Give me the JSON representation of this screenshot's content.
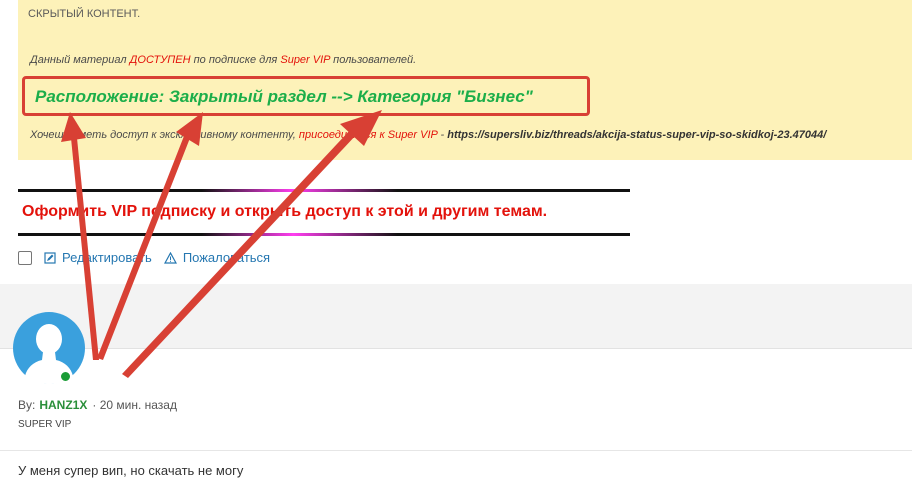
{
  "post": {
    "hidden_content_title": "Скрытый контент.",
    "vip_notice": {
      "pre": "Данный материал ",
      "available": "ДОСТУПЕН",
      "mid": " по подписке для ",
      "super_vip": "Super VIP",
      "post": " пользователей."
    },
    "location_text": "Расположение: Закрытый раздел --> Категория \"Бизнес\"",
    "access_line": {
      "pre": "Хочешь иметь доступ к эксклюзивному контенту, ",
      "join": "присоединяйся к Super VIP",
      "dash": " - ",
      "url": "https://supersliv.biz/threads/akcija-status-super-vip-so-skidkoj-23.47044/"
    },
    "promo_text": "Оформить VIP подписку и открыть доступ к этой и другим темам.",
    "actions": {
      "edit": "Редактировать",
      "report": "Пожаловаться"
    }
  },
  "reply": {
    "by_label": "By:",
    "author": "HANZ1X",
    "time": "20 мин. назад",
    "rank": "SUPER VIP",
    "text": "У меня супер вип, но скачать не могу"
  },
  "colors": {
    "highlight_bg": "#fdf2b9",
    "accent_red": "#e3120b",
    "location_green": "#1cae4a",
    "link_blue": "#2577b1",
    "annotation_red": "#d84034"
  },
  "icons": [
    "edit-icon",
    "warning-icon",
    "avatar-icon"
  ]
}
